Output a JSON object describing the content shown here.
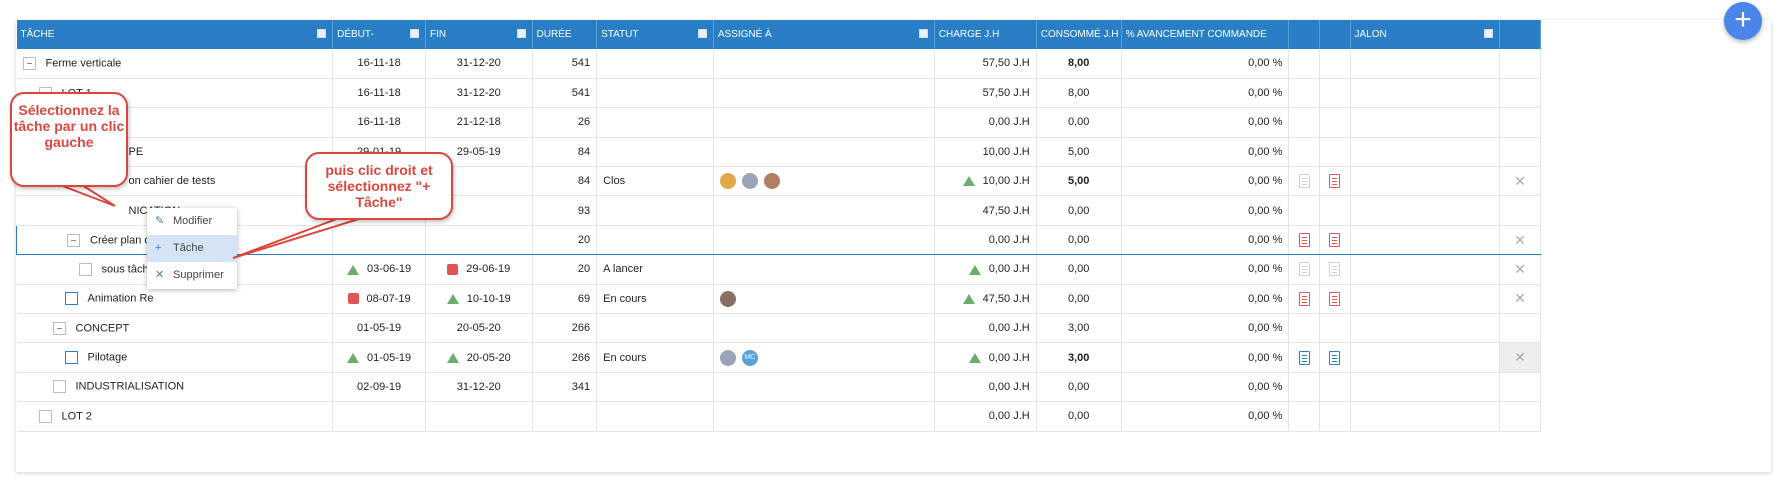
{
  "header": {
    "cols": [
      "TÂCHE",
      "DÉBUT-",
      "FIN",
      "DURÉE",
      "STATUT",
      "ASSIGNÉ À",
      "CHARGE J.H",
      "CONSOMMÉ J.H",
      "% AVANCEMENT COMMANDE",
      "",
      "",
      "JALON",
      ""
    ]
  },
  "rows": [
    {
      "task": "Ferme verticale",
      "start": "16-11-18",
      "end": "31-12-20",
      "dur": "541",
      "status": "",
      "charge": "57,50 J.H",
      "cons": "8,00",
      "pct": "0,00 %"
    },
    {
      "task": "LOT 1",
      "start": "16-11-18",
      "end": "31-12-20",
      "dur": "541",
      "status": "",
      "charge": "57,50 J.H",
      "cons": "8,00",
      "pct": "0,00 %"
    },
    {
      "task": "",
      "start": "16-11-18",
      "end": "21-12-18",
      "dur": "26",
      "status": "",
      "charge": "0,00 J.H",
      "cons": "0,00",
      "pct": "0,00 %"
    },
    {
      "task": "PE",
      "start": "29-01-19",
      "end": "29-05-19",
      "dur": "84",
      "status": "",
      "charge": "10,00 J.H",
      "cons": "5,00",
      "pct": "0,00 %"
    },
    {
      "task": "on cahier de tests",
      "start": "",
      "end": "",
      "dur": "84",
      "status": "Clos",
      "charge": "10,00 J.H",
      "cons": "5,00",
      "pct": "0,00 %"
    },
    {
      "task": "NICATION",
      "start": "",
      "end": "",
      "dur": "93",
      "status": "",
      "charge": "47,50 J.H",
      "cons": "0,00",
      "pct": "0,00 %"
    },
    {
      "task": "Créer plan de com?",
      "start": "",
      "end": "",
      "dur": "20",
      "status": "",
      "charge": "0,00 J.H",
      "cons": "0,00",
      "pct": "0,00 %"
    },
    {
      "task": "sous tâche",
      "start": "03-06-19",
      "end": "29-06-19",
      "dur": "20",
      "status": "A lancer",
      "charge": "0,00 J.H",
      "cons": "0,00",
      "pct": "0,00 %"
    },
    {
      "task": "Animation Re",
      "start": "08-07-19",
      "end": "10-10-19",
      "dur": "69",
      "status": "En cours",
      "charge": "47,50 J.H",
      "cons": "0,00",
      "pct": "0,00 %"
    },
    {
      "task": "CONCEPT",
      "start": "01-05-19",
      "end": "20-05-20",
      "dur": "266",
      "status": "",
      "charge": "0,00 J.H",
      "cons": "3,00",
      "pct": "0,00 %"
    },
    {
      "task": "Pilotage",
      "start": "01-05-19",
      "end": "20-05-20",
      "dur": "266",
      "status": "En cours",
      "charge": "0,00 J.H",
      "cons": "3,00",
      "pct": "0,00 %"
    },
    {
      "task": "INDUSTRIALISATION",
      "start": "02-09-19",
      "end": "31-12-20",
      "dur": "341",
      "status": "",
      "charge": "0,00 J.H",
      "cons": "0,00",
      "pct": "0,00 %"
    },
    {
      "task": "LOT 2",
      "start": "",
      "end": "",
      "dur": "",
      "status": "",
      "charge": "0,00 J.H",
      "cons": "0,00",
      "pct": "0,00 %"
    }
  ],
  "avatars": {
    "mc": "MC"
  },
  "context_menu": {
    "modify": "Modifier",
    "task": "Tâche",
    "delete": "Supprimer"
  },
  "callouts": {
    "left": "Sélectionnez la tâche par un clic gauche",
    "right": "puis clic droit et sélectionnez \"+ Tâche\""
  },
  "icons": {
    "add": "plus-icon",
    "clipboard": "clipboard-icon",
    "note": "note-icon",
    "close": "close-icon"
  },
  "colors": {
    "header": "#2a7ec5",
    "accent": "#4a86e8",
    "callout": "#d9473e",
    "ok": "#6cad6c",
    "late": "#e25555"
  }
}
